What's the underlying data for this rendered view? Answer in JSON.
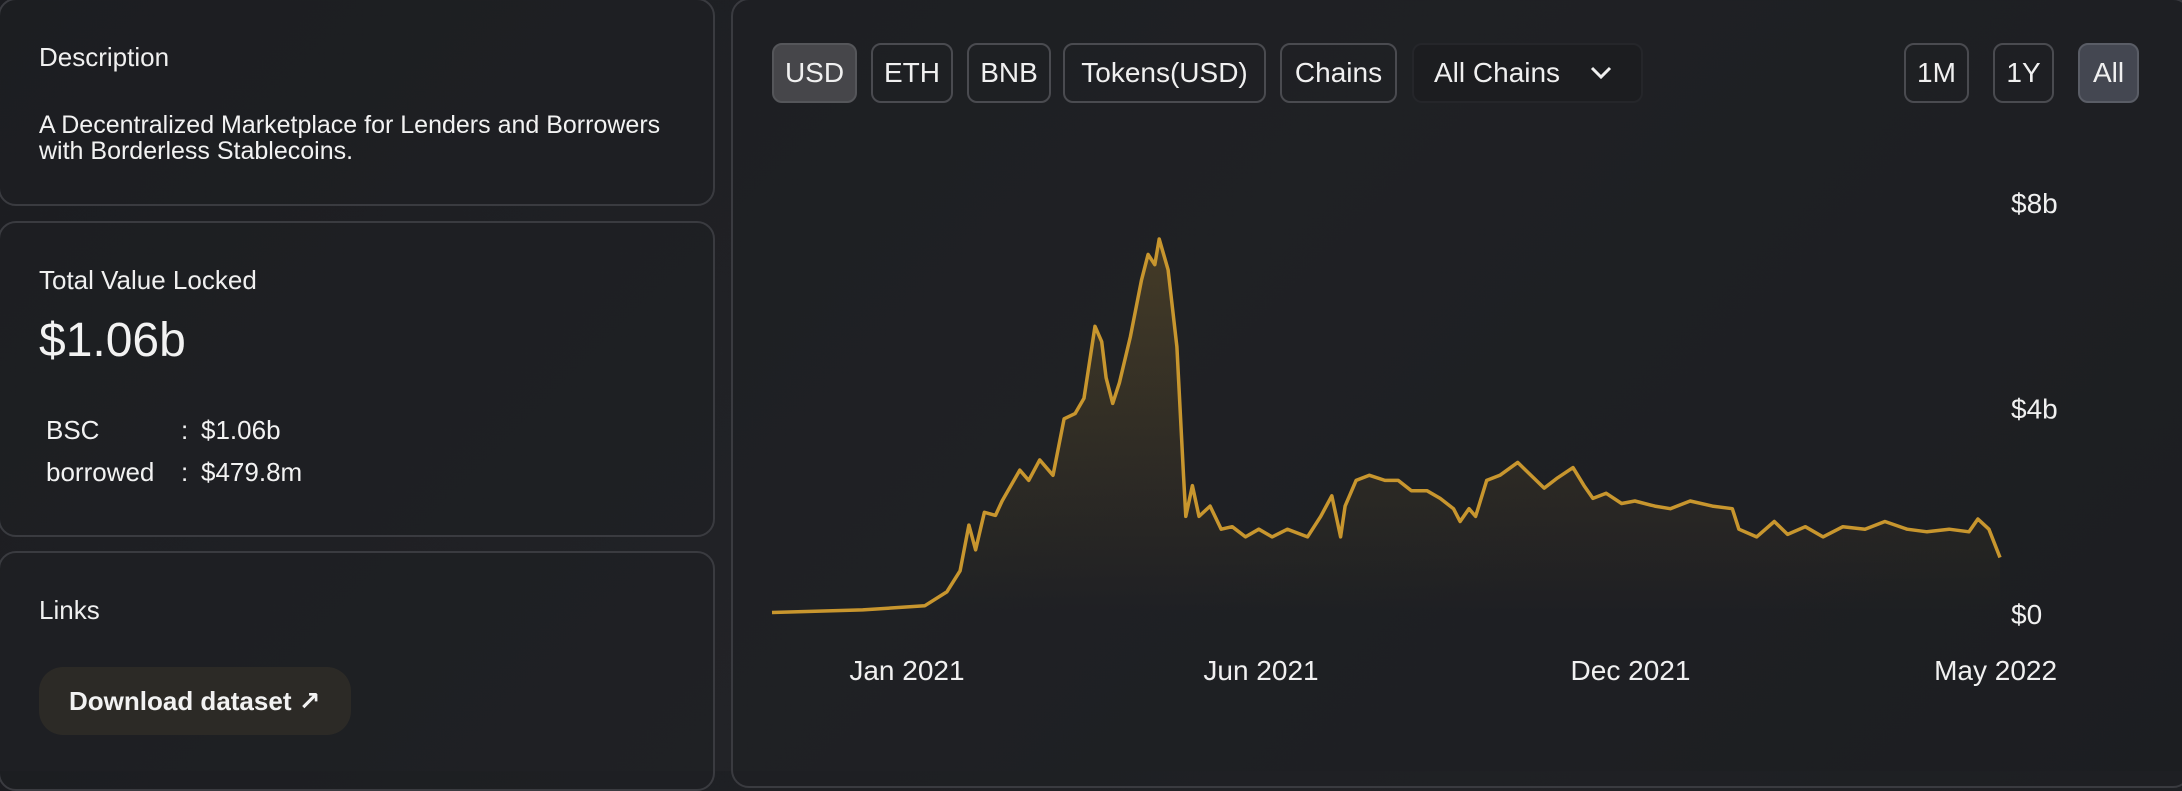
{
  "description": {
    "title": "Description",
    "text": "A Decentralized Marketplace for Lenders and Borrowers with Borderless Stablecoins."
  },
  "tvl": {
    "title": "Total Value Locked",
    "value": "$1.06b",
    "breakdown": [
      {
        "label": "BSC",
        "sep": ":",
        "value": "$1.06b"
      },
      {
        "label": "borrowed",
        "sep": ":",
        "value": "$479.8m"
      }
    ]
  },
  "links": {
    "title": "Links",
    "download_label": "Download dataset",
    "download_icon": "arrow-up-right-icon"
  },
  "toolbar": {
    "denominations": [
      {
        "label": "USD",
        "active": true
      },
      {
        "label": "ETH",
        "active": false
      },
      {
        "label": "BNB",
        "active": false
      },
      {
        "label": "Tokens(USD)",
        "active": false
      },
      {
        "label": "Chains",
        "active": false
      }
    ],
    "chain_select": {
      "value": "All Chains",
      "icon": "chevron-down-icon"
    },
    "ranges": [
      {
        "label": "1M",
        "active": false
      },
      {
        "label": "1Y",
        "active": false
      },
      {
        "label": "All",
        "active": true
      }
    ]
  },
  "chart_data": {
    "type": "area",
    "color": "#c8962e",
    "ylim": [
      0,
      8
    ],
    "y_ticks": [
      {
        "value": 0,
        "label": "$0"
      },
      {
        "value": 4,
        "label": "$4b"
      },
      {
        "value": 8,
        "label": "$8b"
      }
    ],
    "xlim": [
      "2020-11-01",
      "2022-05-10"
    ],
    "x_ticks": [
      {
        "date": "2021-01-01",
        "label": "Jan 2021"
      },
      {
        "date": "2021-06-10",
        "label": "Jun 2021"
      },
      {
        "date": "2021-11-24",
        "label": "Dec 2021"
      },
      {
        "date": "2022-05-08",
        "label": "May 2022"
      }
    ],
    "y_unit": "$b",
    "points": [
      [
        "2020-11-01",
        0.03
      ],
      [
        "2020-12-12",
        0.08
      ],
      [
        "2021-01-09",
        0.16
      ],
      [
        "2021-01-19",
        0.43
      ],
      [
        "2021-01-25",
        0.84
      ],
      [
        "2021-01-29",
        1.73
      ],
      [
        "2021-02-01",
        1.25
      ],
      [
        "2021-02-05",
        1.98
      ],
      [
        "2021-02-10",
        1.92
      ],
      [
        "2021-02-13",
        2.2
      ],
      [
        "2021-02-21",
        2.8
      ],
      [
        "2021-02-25",
        2.6
      ],
      [
        "2021-03-02",
        3.0
      ],
      [
        "2021-03-08",
        2.7
      ],
      [
        "2021-03-13",
        3.8
      ],
      [
        "2021-03-18",
        3.9
      ],
      [
        "2021-03-22",
        4.2
      ],
      [
        "2021-03-27",
        5.6
      ],
      [
        "2021-03-30",
        5.3
      ],
      [
        "2021-04-01",
        4.6
      ],
      [
        "2021-04-04",
        4.1
      ],
      [
        "2021-04-07",
        4.5
      ],
      [
        "2021-04-12",
        5.4
      ],
      [
        "2021-04-17",
        6.5
      ],
      [
        "2021-04-20",
        7.0
      ],
      [
        "2021-04-23",
        6.8
      ],
      [
        "2021-04-25",
        7.3
      ],
      [
        "2021-04-29",
        6.7
      ],
      [
        "2021-05-03",
        5.2
      ],
      [
        "2021-05-06",
        2.7
      ],
      [
        "2021-05-07",
        1.9
      ],
      [
        "2021-05-10",
        2.5
      ],
      [
        "2021-05-13",
        1.9
      ],
      [
        "2021-05-18",
        2.1
      ],
      [
        "2021-05-23",
        1.65
      ],
      [
        "2021-05-28",
        1.7
      ],
      [
        "2021-06-03",
        1.5
      ],
      [
        "2021-06-09",
        1.65
      ],
      [
        "2021-06-15",
        1.5
      ],
      [
        "2021-06-22",
        1.65
      ],
      [
        "2021-07-01",
        1.5
      ],
      [
        "2021-07-07",
        1.9
      ],
      [
        "2021-07-12",
        2.3
      ],
      [
        "2021-07-16",
        1.5
      ],
      [
        "2021-07-18",
        2.1
      ],
      [
        "2021-07-23",
        2.6
      ],
      [
        "2021-07-29",
        2.7
      ],
      [
        "2021-08-05",
        2.6
      ],
      [
        "2021-08-11",
        2.6
      ],
      [
        "2021-08-17",
        2.4
      ],
      [
        "2021-08-24",
        2.4
      ],
      [
        "2021-08-30",
        2.25
      ],
      [
        "2021-09-05",
        2.05
      ],
      [
        "2021-09-08",
        1.8
      ],
      [
        "2021-09-12",
        2.05
      ],
      [
        "2021-09-15",
        1.9
      ],
      [
        "2021-09-20",
        2.6
      ],
      [
        "2021-09-26",
        2.7
      ],
      [
        "2021-10-04",
        2.95
      ],
      [
        "2021-10-10",
        2.7
      ],
      [
        "2021-10-16",
        2.45
      ],
      [
        "2021-10-22",
        2.65
      ],
      [
        "2021-10-29",
        2.85
      ],
      [
        "2021-11-03",
        2.5
      ],
      [
        "2021-11-07",
        2.25
      ],
      [
        "2021-11-13",
        2.35
      ],
      [
        "2021-11-20",
        2.15
      ],
      [
        "2021-11-26",
        2.2
      ],
      [
        "2021-12-05",
        2.1
      ],
      [
        "2021-12-12",
        2.05
      ],
      [
        "2021-12-21",
        2.2
      ],
      [
        "2021-12-31",
        2.1
      ],
      [
        "2022-01-09",
        2.05
      ],
      [
        "2022-01-12",
        1.65
      ],
      [
        "2022-01-20",
        1.5
      ],
      [
        "2022-01-28",
        1.8
      ],
      [
        "2022-02-03",
        1.55
      ],
      [
        "2022-02-11",
        1.7
      ],
      [
        "2022-02-19",
        1.5
      ],
      [
        "2022-02-28",
        1.7
      ],
      [
        "2022-03-10",
        1.65
      ],
      [
        "2022-03-19",
        1.8
      ],
      [
        "2022-03-29",
        1.65
      ],
      [
        "2022-04-07",
        1.6
      ],
      [
        "2022-04-17",
        1.65
      ],
      [
        "2022-04-26",
        1.6
      ],
      [
        "2022-04-30",
        1.85
      ],
      [
        "2022-05-05",
        1.65
      ],
      [
        "2022-05-10",
        1.1
      ]
    ]
  }
}
